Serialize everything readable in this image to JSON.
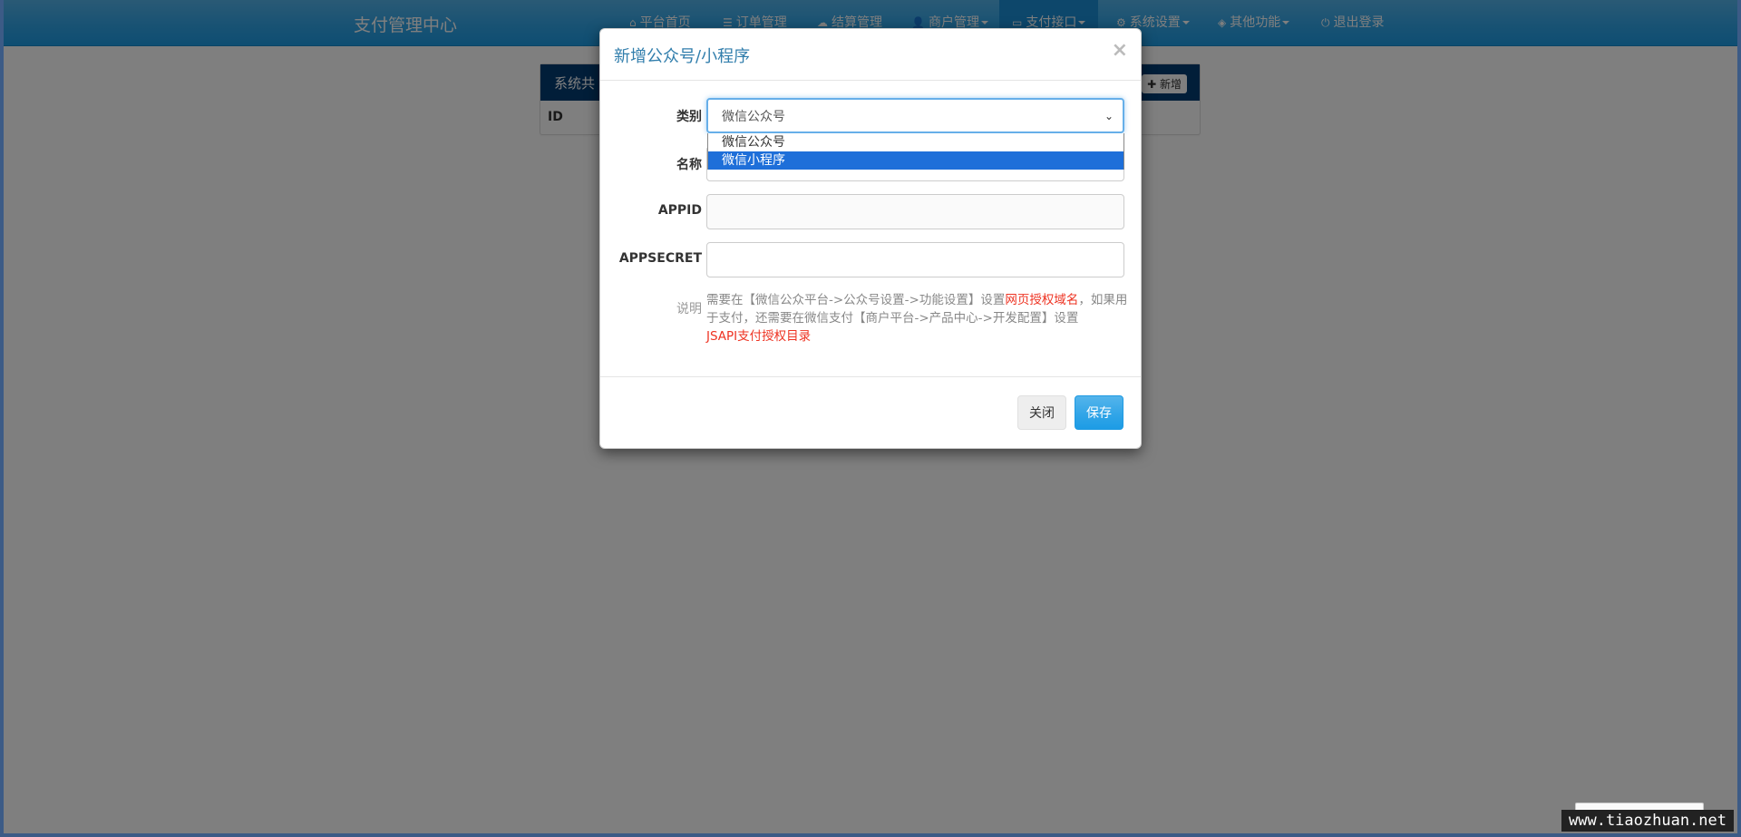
{
  "nav": {
    "brand": "支付管理中心",
    "items": [
      {
        "icon": "home-icon",
        "glyph": "⌂",
        "label": "平台首页"
      },
      {
        "icon": "list-icon",
        "glyph": "☰",
        "label": "订单管理"
      },
      {
        "icon": "cloud-icon",
        "glyph": "☁",
        "label": "结算管理"
      },
      {
        "icon": "user-icon",
        "glyph": "👤",
        "label": "商户管理"
      },
      {
        "icon": "card-icon",
        "glyph": "▭",
        "label": "支付接口"
      },
      {
        "icon": "gear-icon",
        "glyph": "⚙",
        "label": "系统设置"
      },
      {
        "icon": "cube-icon",
        "glyph": "◈",
        "label": "其他功能"
      },
      {
        "icon": "power-icon",
        "glyph": "⏻",
        "label": "退出登录"
      }
    ]
  },
  "panel": {
    "heading": "系统共",
    "add_label": "新增",
    "column_id": "ID"
  },
  "modal": {
    "title": "新增公众号/小程序",
    "close_glyph": "×",
    "fields": {
      "type_label": "类别",
      "type_value": "微信公众号",
      "name_label": "名称",
      "appid_label": "APPID",
      "appsecret_label": "APPSECRET",
      "note_label": "说明"
    },
    "dropdown_options": [
      "微信公众号",
      "微信小程序"
    ],
    "dropdown_highlighted": "微信小程序",
    "help": {
      "part1": "需要在【微信公众平台->公众号设置->功能设置】设置",
      "red1": "网页授权域名",
      "part2": "，如果用于支付，还需要在微信支付【商户平台->产品中心->开发配置】设置",
      "red2": "JSAPI支付授权目录"
    },
    "close_button": "关闭",
    "save_button": "保存"
  },
  "watermark": "www.tiaozhuan.net",
  "colors": {
    "nav_bg": "#2fa4e7",
    "panel_heading": "#033c73",
    "title_blue": "#317eac",
    "highlight_red": "#ee3322",
    "selected_option": "#1e6fd9"
  }
}
